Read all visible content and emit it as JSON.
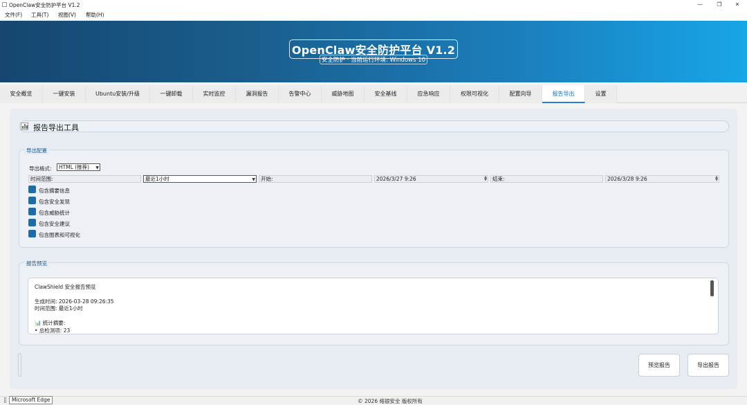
{
  "window": {
    "title": "OpenClaw安全防护平台 V1.2",
    "min_glyph": "—",
    "max_glyph": "❐",
    "close_glyph": "✕"
  },
  "menu": [
    "文件(F)",
    "工具(T)",
    "视图(V)",
    "帮助(H)"
  ],
  "banner": {
    "title": "OpenClaw安全防护平台 V1.2",
    "subtitle": "安全防护 · 当前运行环境: Windows 10"
  },
  "tabs": [
    "安全概览",
    "一键安装",
    "Ubuntu安装/升级",
    "一键卸载",
    "实时监控",
    "漏洞报告",
    "告警中心",
    "威胁地图",
    "安全基线",
    "应急响应",
    "权限可视化",
    "配置向导",
    "报告导出",
    "设置"
  ],
  "active_tab": "报告导出",
  "page": {
    "title": "报告导出工具"
  },
  "export_config": {
    "group_label": "导出配置",
    "format_label": "导出格式:",
    "format_value": "HTML (推荐)",
    "time_range_label": "时间范围:",
    "time_range_value": "最近1小时",
    "start_label": "开始:",
    "start_value": "2026/3/27 9:26",
    "end_label": "结束:",
    "end_value": "2026/3/28 9:26",
    "options": [
      "包含摘要信息",
      "包含安全发现",
      "包含威胁统计",
      "包含安全建议",
      "包含图表和可视化"
    ]
  },
  "preview": {
    "group_label": "报告预览",
    "lines": [
      "ClawShield 安全报告预览",
      "生成时间: 2026-03-28 09:26:35",
      "时间范围: 最近1小时",
      "📊 统计摘要:",
      "• 总检测项: 23"
    ]
  },
  "buttons": {
    "preview": "预览报告",
    "export": "导出报告"
  },
  "footer": "© 2026 络银安全 版权所有",
  "tooltip": "Microsoft Edge",
  "colors": {
    "accent": "#1e73b9",
    "checkbox": "#1c6da8",
    "banner_start": "#15466f",
    "banner_end": "#17a6e8"
  }
}
